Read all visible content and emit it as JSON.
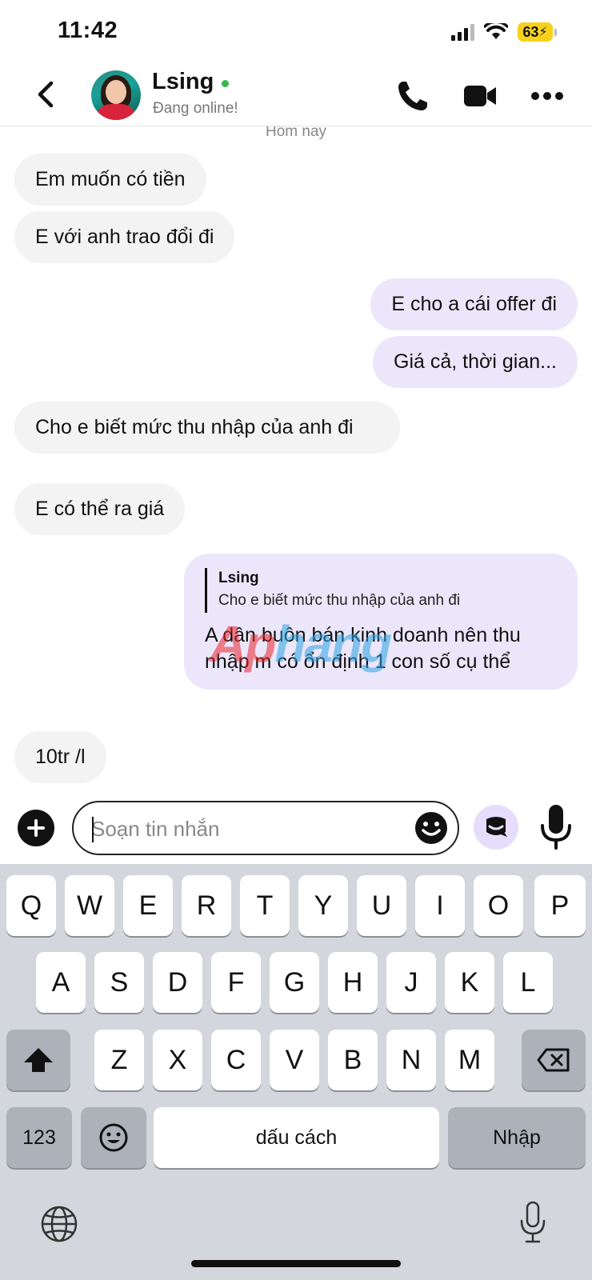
{
  "status_bar": {
    "time": "11:42",
    "battery": "63"
  },
  "header": {
    "contact_name": "Lsing",
    "contact_status": "Đang online!",
    "online_color": "#36b84a"
  },
  "chat": {
    "date_separator": "Hôm nay",
    "messages": [
      {
        "direction": "in",
        "text": "Em muốn có tiền"
      },
      {
        "direction": "in",
        "text": "E với anh trao đổi đi"
      },
      {
        "direction": "out",
        "text": "E cho a cái offer đi"
      },
      {
        "direction": "out",
        "text": "Giá cả, thời gian..."
      },
      {
        "direction": "in",
        "text": "Cho e biết mức thu nhập của anh đi"
      },
      {
        "direction": "in",
        "text": "E có thể ra giá"
      },
      {
        "direction": "out",
        "reply_to_name": "Lsing",
        "reply_to_text": "Cho e biết mức thu nhập của anh đi",
        "text": "A dân buôn bán kinh doanh nên thu nhập m có ổn định 1 con số cụ thể"
      },
      {
        "direction": "in",
        "text": "10tr /l"
      }
    ],
    "watermark": {
      "part1": "Ap",
      "part2": "hang"
    }
  },
  "composer": {
    "placeholder": "Soạn tin nhắn",
    "value": ""
  },
  "keyboard": {
    "row1": [
      "Q",
      "W",
      "E",
      "R",
      "T",
      "Y",
      "U",
      "I",
      "O",
      "P"
    ],
    "row2": [
      "A",
      "S",
      "D",
      "F",
      "G",
      "H",
      "J",
      "K",
      "L"
    ],
    "row3": [
      "Z",
      "X",
      "C",
      "V",
      "B",
      "N",
      "M"
    ],
    "numbers_key": "123",
    "space_key": "dấu cách",
    "return_key": "Nhập"
  },
  "colors": {
    "incoming_bubble": "#f3f3f3",
    "outgoing_bubble": "#ece6fb",
    "keyboard_bg": "#d3d6dc"
  },
  "icons": [
    "back-icon",
    "phone-icon",
    "video-icon",
    "more-icon",
    "plus-icon",
    "emoji-icon",
    "sticker-icon",
    "microphone-icon",
    "shift-icon",
    "backspace-icon",
    "globe-icon",
    "dictation-icon"
  ]
}
